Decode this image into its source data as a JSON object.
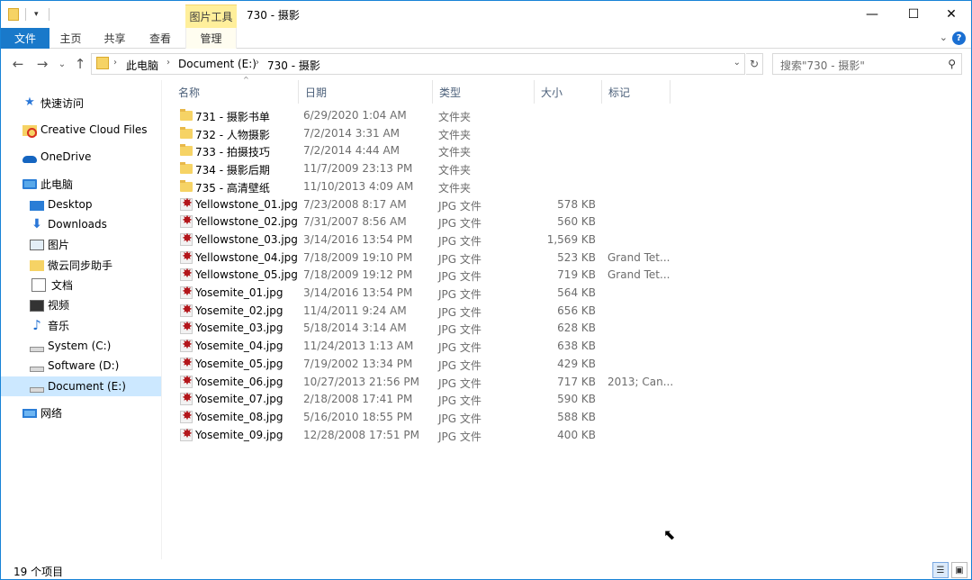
{
  "window": {
    "title": "730 - 摄影",
    "context_tab_header": "图片工具",
    "controls": {
      "minimize": "—",
      "maximize": "☐",
      "close": "✕"
    }
  },
  "ribbon": {
    "tabs": [
      {
        "label": "文件"
      },
      {
        "label": "主页"
      },
      {
        "label": "共享"
      },
      {
        "label": "查看"
      },
      {
        "label": "管理"
      }
    ],
    "collapse_glyph": "⌄",
    "help_glyph": "?"
  },
  "navigation": {
    "back": "←",
    "forward": "→",
    "recent": "⌄",
    "up": "↑"
  },
  "address": {
    "crumbs": [
      "此电脑",
      "Document (E:)",
      "730 - 摄影"
    ],
    "separator": "›",
    "dropdown": "⌄",
    "refresh": "↻"
  },
  "search": {
    "placeholder": "搜索\"730 - 摄影\"",
    "icon": "search-icon"
  },
  "sidebar": {
    "items": [
      {
        "label": "快速访问",
        "icon": "star-icon"
      },
      {
        "label": "Creative Cloud Files",
        "icon": "creative-cloud-folder-icon"
      },
      {
        "label": "OneDrive",
        "icon": "onedrive-cloud-icon"
      },
      {
        "label": "此电脑",
        "icon": "computer-icon"
      },
      {
        "label": "Desktop",
        "icon": "desktop-icon"
      },
      {
        "label": "Downloads",
        "icon": "download-arrow-icon"
      },
      {
        "label": "图片",
        "icon": "pictures-icon"
      },
      {
        "label": "微云同步助手",
        "icon": "folder-icon"
      },
      {
        "label": "文档",
        "icon": "document-icon"
      },
      {
        "label": "视频",
        "icon": "video-icon"
      },
      {
        "label": "音乐",
        "icon": "music-note-icon"
      },
      {
        "label": "System (C:)",
        "icon": "drive-icon"
      },
      {
        "label": "Software (D:)",
        "icon": "drive-icon"
      },
      {
        "label": "Document (E:)",
        "icon": "drive-icon",
        "selected": true
      },
      {
        "label": "网络",
        "icon": "network-icon"
      }
    ]
  },
  "file_list": {
    "columns": [
      "名称",
      "日期",
      "类型",
      "大小",
      "标记"
    ],
    "sort_indicator": "^",
    "rows": [
      {
        "kind": "folder",
        "name": "731 - 摄影书单",
        "date": "6/29/2020 1:04 AM",
        "type": "文件夹",
        "size": "",
        "tag": ""
      },
      {
        "kind": "folder",
        "name": "732 - 人物摄影",
        "date": "7/2/2014 3:31 AM",
        "type": "文件夹",
        "size": "",
        "tag": ""
      },
      {
        "kind": "folder",
        "name": "733 - 拍摄技巧",
        "date": "7/2/2014 4:44 AM",
        "type": "文件夹",
        "size": "",
        "tag": ""
      },
      {
        "kind": "folder",
        "name": "734 - 摄影后期",
        "date": "11/7/2009 23:13 PM",
        "type": "文件夹",
        "size": "",
        "tag": ""
      },
      {
        "kind": "folder",
        "name": "735 - 高清壁纸",
        "date": "11/10/2013 4:09 AM",
        "type": "文件夹",
        "size": "",
        "tag": ""
      },
      {
        "kind": "jpg",
        "name": "Yellowstone_01.jpg",
        "date": "7/23/2008 8:17 AM",
        "type": "JPG 文件",
        "size": "578 KB",
        "tag": ""
      },
      {
        "kind": "jpg",
        "name": "Yellowstone_02.jpg",
        "date": "7/31/2007 8:56 AM",
        "type": "JPG 文件",
        "size": "560 KB",
        "tag": ""
      },
      {
        "kind": "jpg",
        "name": "Yellowstone_03.jpg",
        "date": "3/14/2016 13:54 PM",
        "type": "JPG 文件",
        "size": "1,569 KB",
        "tag": ""
      },
      {
        "kind": "jpg",
        "name": "Yellowstone_04.jpg",
        "date": "7/18/2009 19:10 PM",
        "type": "JPG 文件",
        "size": "523 KB",
        "tag": "Grand Tet..."
      },
      {
        "kind": "jpg",
        "name": "Yellowstone_05.jpg",
        "date": "7/18/2009 19:12 PM",
        "type": "JPG 文件",
        "size": "719 KB",
        "tag": "Grand Tet..."
      },
      {
        "kind": "jpg",
        "name": "Yosemite_01.jpg",
        "date": "3/14/2016 13:54 PM",
        "type": "JPG 文件",
        "size": "564 KB",
        "tag": ""
      },
      {
        "kind": "jpg",
        "name": "Yosemite_02.jpg",
        "date": "11/4/2011 9:24 AM",
        "type": "JPG 文件",
        "size": "656 KB",
        "tag": ""
      },
      {
        "kind": "jpg",
        "name": "Yosemite_03.jpg",
        "date": "5/18/2014 3:14 AM",
        "type": "JPG 文件",
        "size": "628 KB",
        "tag": ""
      },
      {
        "kind": "jpg",
        "name": "Yosemite_04.jpg",
        "date": "11/24/2013 1:13 AM",
        "type": "JPG 文件",
        "size": "638 KB",
        "tag": ""
      },
      {
        "kind": "jpg",
        "name": "Yosemite_05.jpg",
        "date": "7/19/2002 13:34 PM",
        "type": "JPG 文件",
        "size": "429 KB",
        "tag": ""
      },
      {
        "kind": "jpg",
        "name": "Yosemite_06.jpg",
        "date": "10/27/2013 21:56 PM",
        "type": "JPG 文件",
        "size": "717 KB",
        "tag": "2013; Can..."
      },
      {
        "kind": "jpg",
        "name": "Yosemite_07.jpg",
        "date": "2/18/2008 17:41 PM",
        "type": "JPG 文件",
        "size": "590 KB",
        "tag": ""
      },
      {
        "kind": "jpg",
        "name": "Yosemite_08.jpg",
        "date": "5/16/2010 18:55 PM",
        "type": "JPG 文件",
        "size": "588 KB",
        "tag": ""
      },
      {
        "kind": "jpg",
        "name": "Yosemite_09.jpg",
        "date": "12/28/2008 17:51 PM",
        "type": "JPG 文件",
        "size": "400 KB",
        "tag": ""
      }
    ]
  },
  "status": {
    "item_count": "19 个项目"
  },
  "colors": {
    "accent": "#1979ca",
    "selected": "#cce8ff",
    "context_tab": "#ffef9b",
    "header_text": "#4c607a",
    "secondary_text": "#6d6d6d"
  }
}
